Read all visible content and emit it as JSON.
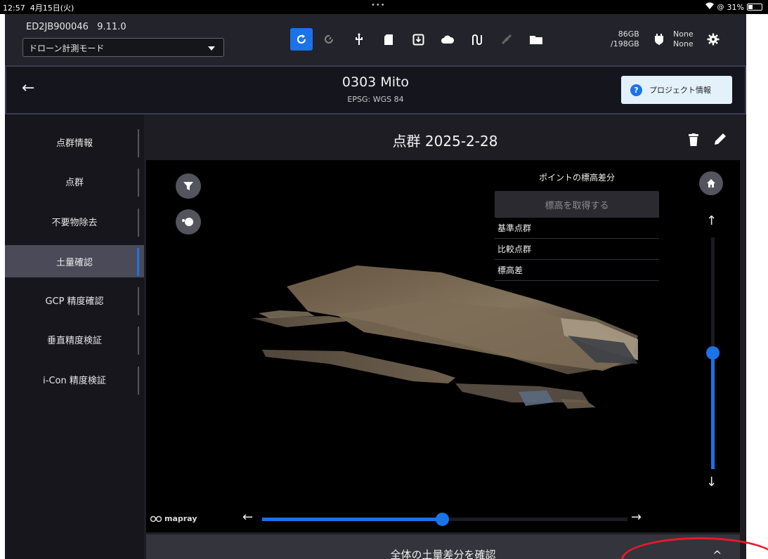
{
  "statusbar": {
    "time": "12:57",
    "date": "4月15日(火)",
    "battery_text": "31%",
    "battery_level": 0.31
  },
  "appbar": {
    "device_id": "ED2JB900046",
    "version": "9.11.0",
    "mode": "ドローン計測モード",
    "storage_used": "86GB",
    "storage_total": "/198GB",
    "power_line1": "None",
    "power_line2": "None"
  },
  "project": {
    "title": "0303 Mito",
    "crs": "EPSG: WGS 84",
    "info_button": "プロジェクト情報"
  },
  "sidebar": {
    "items": [
      {
        "label": "点群情報"
      },
      {
        "label": "点群"
      },
      {
        "label": "不要物除去"
      },
      {
        "label": "土量確認"
      },
      {
        "label": "GCP 精度確認"
      },
      {
        "label": "垂直精度検証"
      },
      {
        "label": "i-Con 精度検証"
      }
    ],
    "active_index": 3
  },
  "main": {
    "title": "点群 2025-2-28"
  },
  "panel": {
    "title": "ポイントの標高差分",
    "get_elevation_button": "標高を取得する",
    "rows": [
      "基準点群",
      "比較点群",
      "標高差"
    ]
  },
  "viewer": {
    "logo": "mapray",
    "vertical_slider_level": 0.5,
    "horizontal_slider_level": 0.49
  },
  "bottom": {
    "label": "全体の土量差分を確認"
  },
  "colors": {
    "accent": "#1a73e8",
    "annotation": "#e8192c"
  }
}
